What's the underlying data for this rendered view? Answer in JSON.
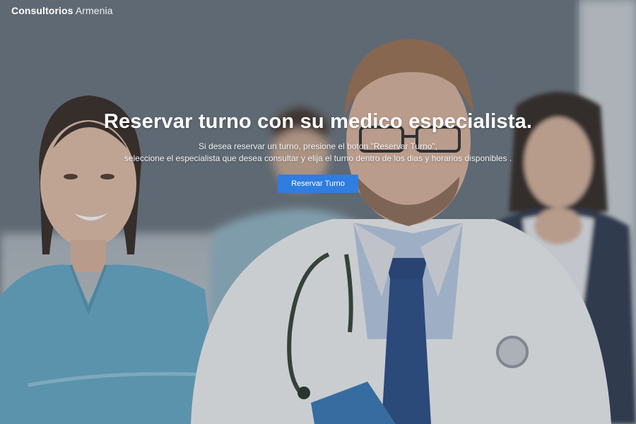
{
  "navbar": {
    "brand_strong": "Consultorios",
    "brand_light": "Armenia"
  },
  "hero": {
    "title": "Reservar turno con su medico especialista.",
    "subtitle_line1": "Si desea reservar un turno, presione el boton \"Reservar Turno\",",
    "subtitle_line2": "seleccione el especialista que desea consultar y elija el turno dentro de los dias y horarios disponibles .",
    "cta_label": "Reservar Turno"
  },
  "colors": {
    "button": "#2f7de1",
    "text": "#ffffff"
  }
}
